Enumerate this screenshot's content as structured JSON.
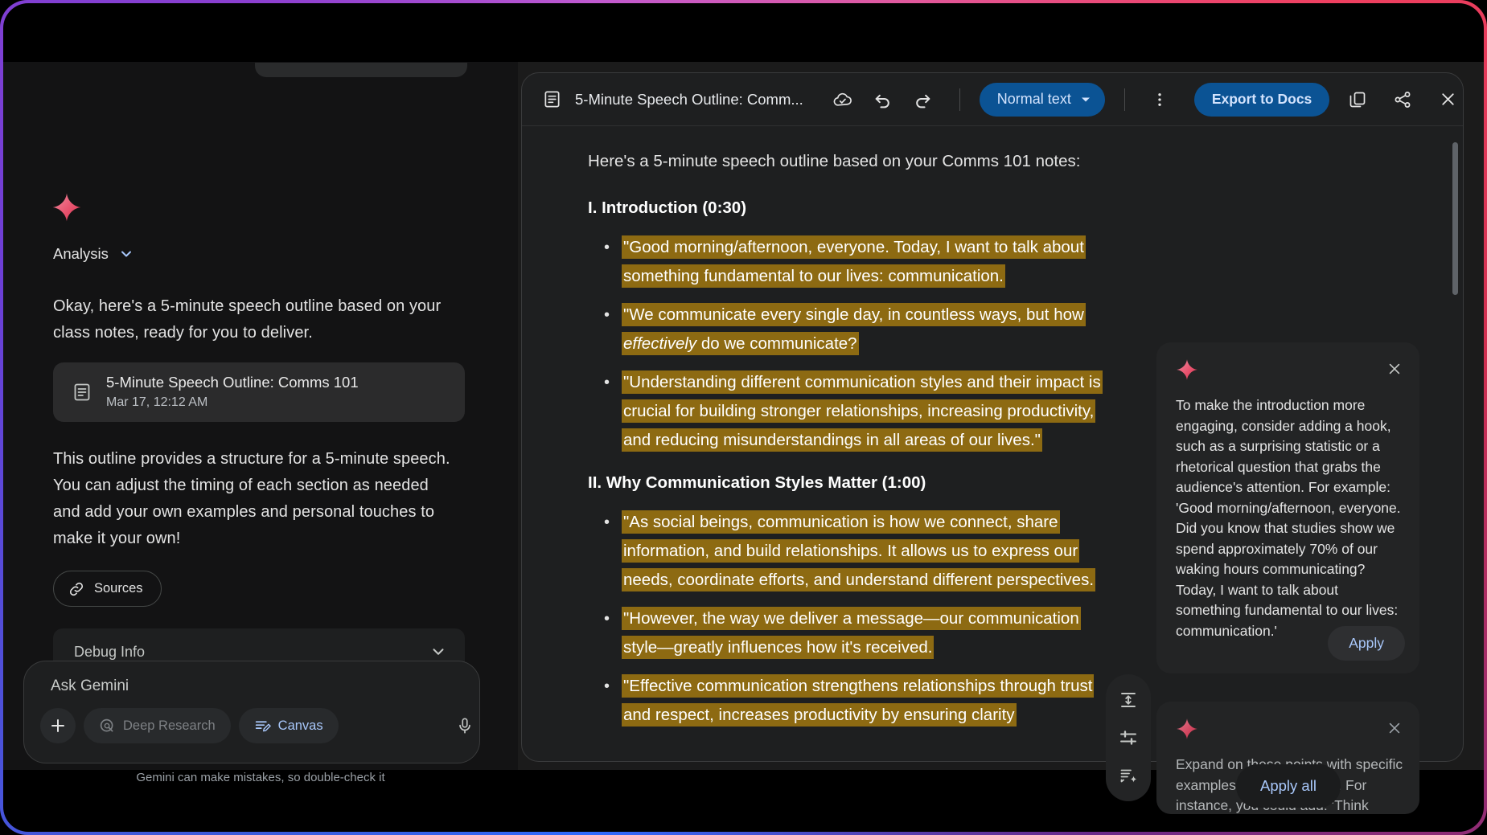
{
  "left_panel": {
    "analysis_label": "Analysis",
    "intro_text": "Okay, here's a 5-minute speech outline based on your class notes, ready for you to deliver.",
    "doc_chip": {
      "title": "5-Minute Speech Outline: Comms 101",
      "subtitle": "Mar 17, 12:12 AM"
    },
    "outline_note": "This outline provides a structure for a 5-minute speech.  You can adjust the timing of each section as needed and add your own examples and personal touches to make it your own!",
    "sources_label": "Sources",
    "debug_info_label": "Debug Info",
    "composer": {
      "placeholder": "Ask Gemini",
      "deep_research_label": "Deep Research",
      "canvas_label": "Canvas"
    },
    "disclaimer": "Gemini can make mistakes, so double-check it"
  },
  "canvas": {
    "doc_title": "5-Minute Speech Outline: Comm...",
    "style_select_value": "Normal text",
    "export_label": "Export to Docs",
    "document": {
      "intro_paragraph": "Here's a 5-minute speech outline based on your Comms 101 notes:",
      "sections": [
        {
          "heading": "I. Introduction (0:30)",
          "bullets": [
            "\"Good morning/afternoon, everyone. Today, I want to talk about something fundamental to our lives: communication.",
            "\"We communicate every single day, in countless ways, but how effectively do we communicate?",
            "\"Understanding different communication styles and their impact is crucial for building stronger relationships, increasing productivity, and reducing misunderstandings in all areas of our lives.\""
          ]
        },
        {
          "heading": "II. Why Communication Styles Matter (1:00)",
          "bullets": [
            "\"As social beings, communication is how we connect, share information, and build relationships. It allows us to express our needs, coordinate efforts, and understand different perspectives.",
            "\"However, the way we deliver a message—our communication style—greatly influences how it's received.",
            "\"Effective communication strengthens relationships through trust and respect, increases productivity by ensuring clarity"
          ]
        }
      ]
    }
  },
  "suggestions": [
    {
      "text": "To make the introduction more engaging, consider adding a hook, such as a surprising statistic or a rhetorical question that grabs the audience's attention. For example: 'Good morning/afternoon, everyone. Did you know that studies show we spend approximately 70% of our waking hours communicating? Today, I want to talk about something fundamental to our lives: communication.'",
      "apply_label": "Apply"
    },
    {
      "text": "Expand on these points with specific examples from your notes. For instance, you could add: 'Think about a",
      "apply_label": ""
    }
  ],
  "apply_all_label": "Apply all",
  "colors": {
    "highlight": "#8d6a12",
    "accent_blue": "#0b5394",
    "accent_text": "#a8c7fa",
    "panel_bg": "#1e1f20",
    "left_bg": "#131314"
  }
}
